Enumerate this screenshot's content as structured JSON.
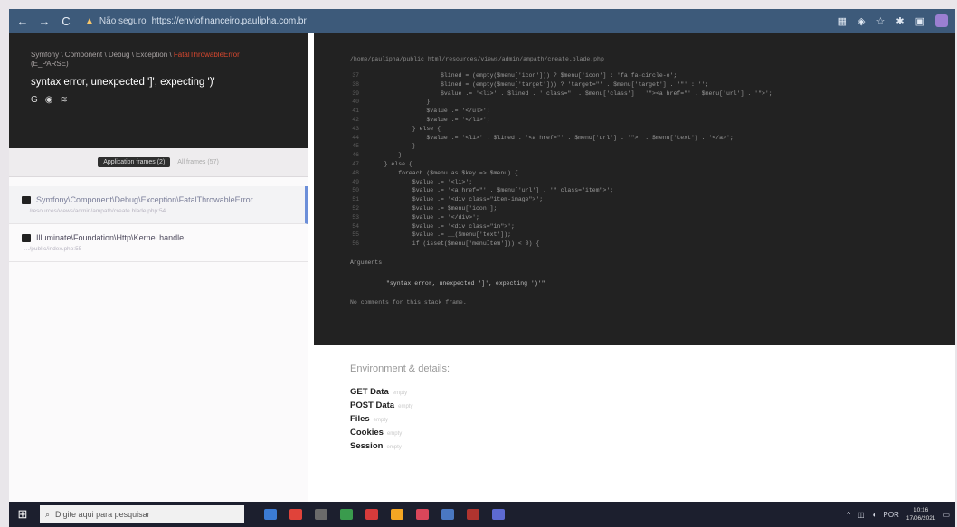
{
  "browser": {
    "nav_back": "←",
    "nav_forward": "→",
    "nav_reload": "C",
    "security_label": "Não seguro",
    "url": "https://enviofinanceiro.paulipha.com.br",
    "toolbar_icons": [
      "grid-icon",
      "extension-icon",
      "star-icon",
      "pin-icon",
      "window-icon",
      "profile-icon"
    ]
  },
  "error": {
    "path_prefix": "Symfony \\ Component \\ Debug \\ Exception \\",
    "path_highlight": "FatalThrowableError",
    "path_code": "(E_PARSE)",
    "message": "syntax error, unexpected ']', expecting ')'",
    "header_icons": [
      "google-icon",
      "duckduckgo-icon",
      "stackoverflow-icon"
    ]
  },
  "tabs": {
    "active": "Application frames (2)",
    "inactive": "All frames (57)"
  },
  "frames": [
    {
      "title": "Symfony\\Component\\Debug\\Exception\\FatalThrowableError",
      "file": "…/resources/views/admin/ampath/create.blade.php:54",
      "selected": true
    },
    {
      "title": "Illuminate\\Foundation\\Http\\Kernel handle",
      "file": "…/public/index.php:55",
      "selected": false
    }
  ],
  "code": {
    "file": "/home/paulipha/public_html/resources/views/admin/ampath/create.blade.php",
    "lines": [
      {
        "n": "37",
        "t": "                    $lined = (empty($menu['icon'])) ? $menu['icon'] : 'fa fa-circle-o';"
      },
      {
        "n": "38",
        "t": "                    $lined = (empty($menu['target'])) ? 'target=\"' . $menu['target'] . '\"' : '';"
      },
      {
        "n": "39",
        "t": "                    $value .= '<li>' . $lined . ' class=\"' . $menu['class'] . '\"><a href=\"' . $menu['url'] . '\">';"
      },
      {
        "n": "40",
        "t": "                }"
      },
      {
        "n": "41",
        "t": "                $value .= '</ul>';"
      },
      {
        "n": "42",
        "t": "                $value .= '</li>';"
      },
      {
        "n": "43",
        "t": "            } else {"
      },
      {
        "n": "44",
        "t": "                $value .= '<li>' . $lined . '<a href=\"' . $menu['url'] . '\">' . $menu['text'] . '</a>';"
      },
      {
        "n": "45",
        "t": "            }"
      },
      {
        "n": "46",
        "t": "        }"
      },
      {
        "n": "47",
        "t": "    } else {"
      },
      {
        "n": "48",
        "t": "        foreach ($menu as $key => $menu) {"
      },
      {
        "n": "49",
        "t": "            $value .= '<li>';"
      },
      {
        "n": "50",
        "t": "            $value .= '<a href=\"' . $menu['url'] . '\" class=\"item\">';"
      },
      {
        "n": "51",
        "t": "            $value .= '<div class=\"item-image\">';"
      },
      {
        "n": "52",
        "t": "            $value .= $menu['icon'];"
      },
      {
        "n": "53",
        "t": "            $value .= '</div>';"
      },
      {
        "n": "54",
        "t": "            $value .= '<div class=\"in\">';"
      },
      {
        "n": "55",
        "t": "            $value .= __($menu['text']);"
      },
      {
        "n": "56",
        "t": "            if (isset($menu['menuItem'])) < 0) {"
      }
    ],
    "arguments_label": "Arguments",
    "argument_value": "\"syntax error, unexpected ']', expecting ')'\"",
    "no_comments": "No comments for this stack frame."
  },
  "env": {
    "title": "Environment & details:",
    "items": [
      {
        "key": "GET Data",
        "value": "empty"
      },
      {
        "key": "POST Data",
        "value": "empty"
      },
      {
        "key": "Files",
        "value": "empty"
      },
      {
        "key": "Cookies",
        "value": "empty"
      },
      {
        "key": "Session",
        "value": "empty"
      }
    ]
  },
  "taskbar": {
    "search_placeholder": "Digite aqui para pesquisar",
    "tray_lang": "POR",
    "time": "10:16",
    "date": "17/06/2021",
    "app_colors": [
      "#3b7bd4",
      "#e0433a",
      "#6a6a6a",
      "#3a9b4d",
      "#d63b3b",
      "#f5a623",
      "#d9465a",
      "#4a78c2",
      "#b0342f",
      "#5d6ad1"
    ]
  }
}
